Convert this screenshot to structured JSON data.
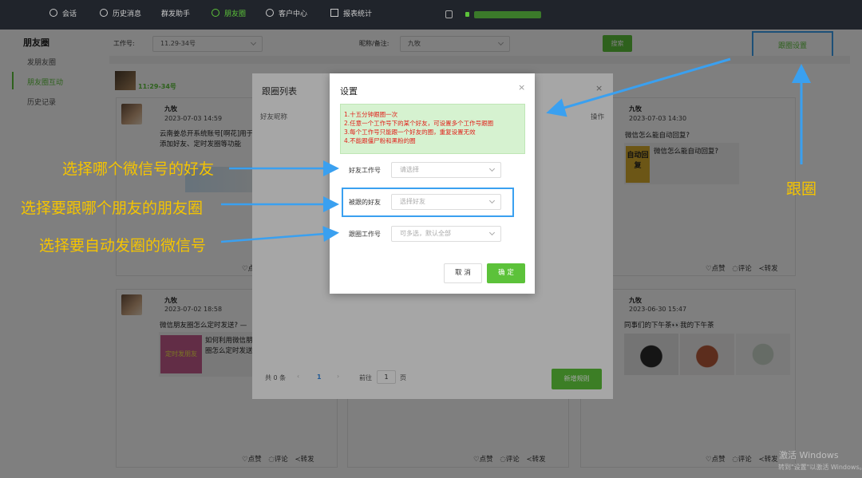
{
  "topnav": {
    "items": [
      {
        "label": "会话"
      },
      {
        "label": "历史消息"
      },
      {
        "label": "群发助手"
      },
      {
        "label": "朋友圈"
      },
      {
        "label": "客户中心"
      },
      {
        "label": "报表统计"
      }
    ]
  },
  "sidebar": {
    "title": "朋友圈",
    "items": [
      {
        "label": "发朋友圈"
      },
      {
        "label": "朋友圈互动"
      },
      {
        "label": "历史记录"
      }
    ]
  },
  "search": {
    "account_label": "工作号:",
    "account_value": "11.29-34号",
    "nickname_label": "昵称/备注:",
    "nickname_value": "九牧",
    "search_button": "搜索",
    "follow_settings": "跟圈设置"
  },
  "account_header": {
    "name": "11:29-34号"
  },
  "posts": [
    {
      "name": "九牧",
      "time": "2023-07-03 14:59",
      "text1": "云南姜总开系统账号[啊花]用于",
      "text2": "添加好友、定时发圈等功能",
      "actions": {
        "like": "点赞"
      }
    },
    {
      "name": "九牧",
      "time": "2023-07-03 14:30",
      "text1": "微信怎么能自动回复?",
      "link_text": "微信怎么能自动回复?",
      "thumb_text": "自动回复",
      "actions": {
        "like": "点赞",
        "comment": "评论",
        "share": "转发"
      }
    },
    {
      "name": "九牧",
      "time": "2023-07-02 18:58",
      "text1": "微信朋友圈怎么定时发送? —",
      "link_text1": "如何利用微信朋",
      "link_text2": "圈怎么定时发送",
      "thumb_text": "定时发朋友",
      "actions": {
        "like": "点赞",
        "comment": "评论",
        "share": "转发"
      }
    },
    {
      "name": "九牧",
      "time": "2023-06-30 15:47",
      "text1": "同事们的下午茶👀我的下午茶",
      "actions": {
        "like": "点赞",
        "comment": "评论",
        "share": "转发"
      }
    },
    {
      "actions": {
        "like": "点赞",
        "comment": "评论",
        "share": "转发"
      }
    }
  ],
  "list_panel": {
    "title": "跟圈列表",
    "col_friend": "好友昵称",
    "col_action": "操作",
    "total": "共 0 条",
    "page": "1",
    "goto_label": "前往",
    "goto_value": "1",
    "page_unit": "页",
    "add_rule": "新增规则"
  },
  "modal": {
    "title": "设置",
    "notice": [
      "1.十五分钟跟圈一次",
      "2.任意一个工作号下的某个好友，可设置多个工作号跟圈",
      "3.每个工作号只能跟一个好友的圈，重复设置无效",
      "4.不能跟僵尸粉和黑粉的圈"
    ],
    "field1_label": "好友工作号",
    "field1_placeholder": "请选择",
    "field2_label": "被跟的好友",
    "field2_placeholder": "选择好友",
    "field3_label": "跟圈工作号",
    "field3_placeholder": "可多选，默认全部",
    "cancel": "取 消",
    "confirm": "确 定"
  },
  "annotations": {
    "a1": "选择哪个微信号的好友",
    "a2": "选择要跟哪个朋友的朋友圈",
    "a3": "选择要自动发圈的微信号",
    "a4": "跟圈"
  },
  "watermark": {
    "line1": "激活 Windows",
    "line2": "转到\"设置\"以激活 Windows。"
  },
  "colors": {
    "accent": "#5cc23a",
    "annotation": "#f5c400",
    "arrow": "#3aa0f0",
    "notice_text": "#e0201a"
  }
}
